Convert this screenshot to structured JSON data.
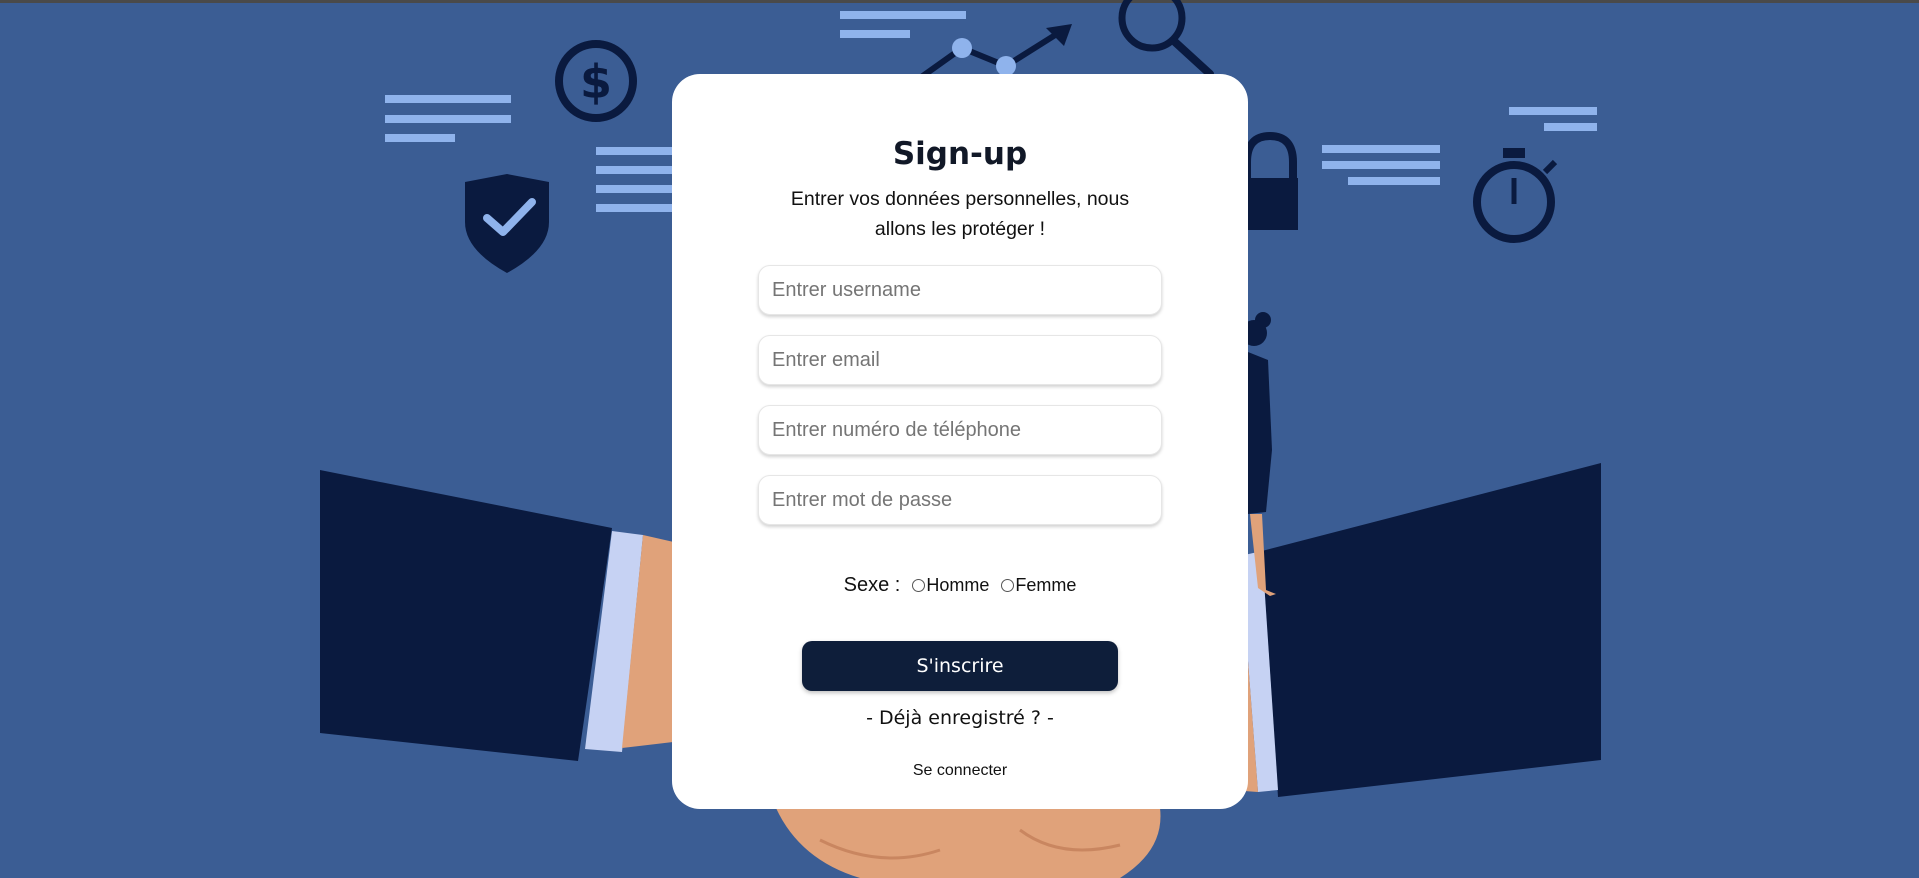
{
  "form": {
    "title": "Sign-up",
    "subtitle": "Entrer vos données personnelles, nous allons les protéger !",
    "fields": {
      "username_placeholder": "Entrer username",
      "email_placeholder": "Entrer email",
      "phone_placeholder": "Entrer numéro de téléphone",
      "password_placeholder": "Entrer mot de passe"
    },
    "sexe": {
      "label": "Sexe :",
      "options": [
        "Homme",
        "Femme"
      ]
    },
    "submit_label": "S'inscrire",
    "already_registered": "- Déjà enregistré ? -",
    "login_link": "Se connecter"
  },
  "colors": {
    "background": "#3b5d94",
    "card": "#ffffff",
    "button": "#0e1e3a",
    "illustration_dark": "#0a1a3f",
    "illustration_light": "#8fb3ec",
    "skin": "#e0a27a"
  },
  "background_icons": [
    "dollar-coin-icon",
    "shield-check-icon",
    "trend-chart-icon",
    "magnifier-icon",
    "padlock-icon",
    "stopwatch-icon",
    "handshake-illustration",
    "woman-figure-illustration"
  ]
}
